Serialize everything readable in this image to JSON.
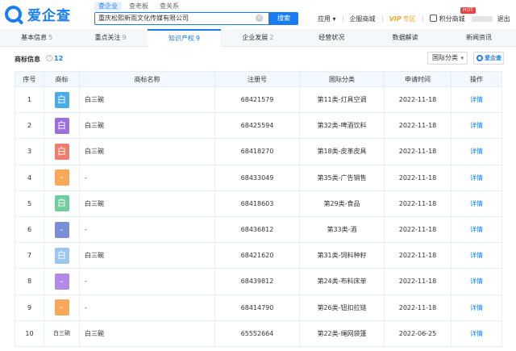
{
  "app": {
    "logo_text": "爱企查",
    "search_tabs": [
      "查企业",
      "查老板",
      "查关系"
    ],
    "search_value": "重庆松熙新雨文化传媒有限公司",
    "search_button": "搜索",
    "top_links": {
      "apps": "应用",
      "enterprise_mall": "企服商城",
      "vip": "VIP",
      "vip_sub": "专区",
      "points_mall": "积分商城",
      "hot_badge": "HOT",
      "logout": "退出"
    }
  },
  "nav": {
    "tabs": [
      {
        "label": "基本信息",
        "count": "5"
      },
      {
        "label": "重点关注",
        "count": "9"
      },
      {
        "label": "知识产权",
        "count": "9"
      },
      {
        "label": "企业发展",
        "count": "2"
      },
      {
        "label": "经营状况",
        "count": ""
      },
      {
        "label": "数据解读",
        "count": ""
      },
      {
        "label": "新闻资讯",
        "count": ""
      }
    ],
    "active_index": 2
  },
  "section": {
    "title": "商标信息",
    "count": "12",
    "filter_label": "国际分类",
    "brand_label": "爱企查"
  },
  "table": {
    "headers": [
      "序号",
      "商标",
      "商标名称",
      "注册号",
      "国际分类",
      "申请时间",
      "操作"
    ],
    "rows": [
      {
        "no": "1",
        "logo_text": "白",
        "logo_color": "#4aabe7",
        "name": "白三碗",
        "reg_no": "68421579",
        "category": "第11类-灯具空调",
        "date": "2022-11-18",
        "action": "详情"
      },
      {
        "no": "2",
        "logo_text": "白",
        "logo_color": "#9b6fdb",
        "name": "白三碗",
        "reg_no": "68425594",
        "category": "第32类-啤酒饮料",
        "date": "2022-11-18",
        "action": "详情"
      },
      {
        "no": "3",
        "logo_text": "白",
        "logo_color": "#ee7d6e",
        "name": "白三碗",
        "reg_no": "68418270",
        "category": "第18类-皮革皮具",
        "date": "2022-11-18",
        "action": "详情"
      },
      {
        "no": "4",
        "logo_text": "-",
        "logo_color": "#f7a85a",
        "name": "-",
        "reg_no": "68433049",
        "category": "第35类-广告销售",
        "date": "2022-11-18",
        "action": "详情"
      },
      {
        "no": "5",
        "logo_text": "白",
        "logo_color": "#6fcda0",
        "name": "白三碗",
        "reg_no": "68418603",
        "category": "第29类-食品",
        "date": "2022-11-18",
        "action": "详情"
      },
      {
        "no": "6",
        "logo_text": "-",
        "logo_color": "#7a8fd8",
        "name": "-",
        "reg_no": "68436812",
        "category": "第33类-酒",
        "date": "2022-11-18",
        "action": "详情"
      },
      {
        "no": "7",
        "logo_text": "白",
        "logo_color": "#9bc6ef",
        "name": "白三碗",
        "reg_no": "68421620",
        "category": "第31类-饲料种籽",
        "date": "2022-11-18",
        "action": "详情"
      },
      {
        "no": "8",
        "logo_text": "-",
        "logo_color": "#b28ae6",
        "name": "-",
        "reg_no": "68439812",
        "category": "第24类-布料床单",
        "date": "2022-11-18",
        "action": "详情"
      },
      {
        "no": "9",
        "logo_text": "-",
        "logo_color": "#f7a85a",
        "name": "-",
        "reg_no": "68414790",
        "category": "第26类-钮扣拉链",
        "date": "2022-11-18",
        "action": "详情"
      },
      {
        "no": "10",
        "logo_text": "白三碗",
        "logo_color": "",
        "name": "白三碗",
        "reg_no": "65552664",
        "category": "第22类-绳网袋篷",
        "date": "2022-06-25",
        "action": "详情"
      }
    ]
  },
  "colors": {
    "accent": "#1a7cf2",
    "header_bg": "#f2f8fe",
    "vip": "#f8a436",
    "hot": "#f04142"
  }
}
